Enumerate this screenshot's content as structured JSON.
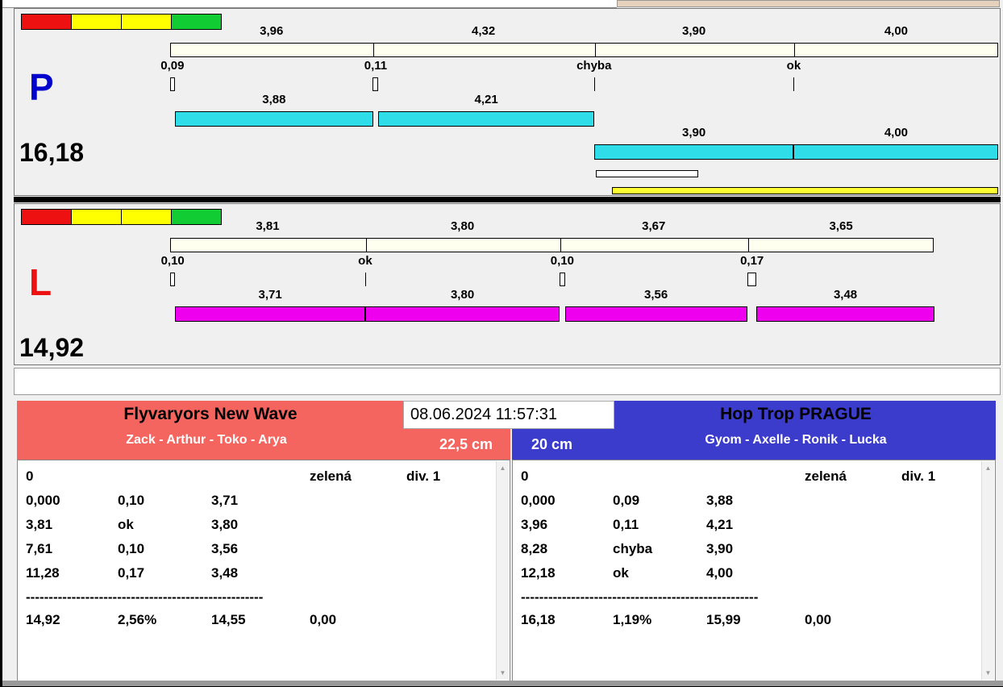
{
  "window": {
    "datetime": "08.06.2024 11:57:31"
  },
  "colors": {
    "p_accent": "#2fdde8",
    "l_accent": "#ee00ee",
    "ruler_fill": "#fffff0",
    "status_segments": [
      "#ee1111",
      "#ffff00",
      "#ffff00",
      "#11cc33"
    ],
    "left_team_bg": "#f5655f",
    "right_team_bg": "#3c3ccc",
    "p_label_color": "#0000cc",
    "l_label_color": "#ee1111",
    "progress_white": "#ffffff",
    "progress_yellow": "#ffff33"
  },
  "icons": {
    "scroll_up": "▲",
    "scroll_down": "▼"
  },
  "lanes": {
    "p": {
      "label": "P",
      "total": "16,18"
    },
    "l": {
      "label": "L",
      "total": "14,92"
    }
  },
  "teams": {
    "left": {
      "name": "Flyvaryors New Wave",
      "members": "Zack - Arthur - Toko - Arya",
      "jump_height": "22,5 cm"
    },
    "right": {
      "name": "Hop Trop PRAGUE",
      "members": "Gyom - Axelle - Ronik - Lucka",
      "jump_height": "20 cm"
    }
  },
  "tables": {
    "left": {
      "rows": [
        [
          {
            "col": 0,
            "text": "0"
          },
          {
            "col": 3,
            "text": "zelená"
          },
          {
            "col": 4,
            "text": "div. 1"
          }
        ],
        [
          {
            "col": 0,
            "text": "0,000"
          },
          {
            "col": 1,
            "text": "0,10"
          },
          {
            "col": 2,
            "text": "3,71"
          }
        ],
        [
          {
            "col": 0,
            "text": "3,81"
          },
          {
            "col": 1,
            "text": "ok"
          },
          {
            "col": 2,
            "text": "3,80"
          }
        ],
        [
          {
            "col": 0,
            "text": "7,61"
          },
          {
            "col": 1,
            "text": "0,10"
          },
          {
            "col": 2,
            "text": "3,56"
          }
        ],
        [
          {
            "col": 0,
            "text": "11,28"
          },
          {
            "col": 1,
            "text": "0,17"
          },
          {
            "col": 2,
            "text": "3,48"
          }
        ]
      ],
      "separator": "----------------------------------------------------",
      "summary": [
        {
          "col": 0,
          "text": "14,92"
        },
        {
          "col": 1,
          "text": "2,56%"
        },
        {
          "col": 2,
          "text": "14,55"
        },
        {
          "col": 3,
          "text": "0,00"
        }
      ]
    },
    "right": {
      "rows": [
        [
          {
            "col": 0,
            "text": "0"
          },
          {
            "col": 3,
            "text": "zelená"
          },
          {
            "col": 4,
            "text": "div. 1"
          }
        ],
        [
          {
            "col": 0,
            "text": "0,000"
          },
          {
            "col": 1,
            "text": "0,09"
          },
          {
            "col": 2,
            "text": "3,88"
          }
        ],
        [
          {
            "col": 0,
            "text": "3,96"
          },
          {
            "col": 1,
            "text": "0,11"
          },
          {
            "col": 2,
            "text": "4,21"
          }
        ],
        [
          {
            "col": 0,
            "text": "8,28"
          },
          {
            "col": 1,
            "text": "chyba"
          },
          {
            "col": 2,
            "text": "3,90"
          }
        ],
        [
          {
            "col": 0,
            "text": "12,18"
          },
          {
            "col": 1,
            "text": "ok"
          },
          {
            "col": 2,
            "text": "4,00"
          }
        ]
      ],
      "separator": "----------------------------------------------------",
      "summary": [
        {
          "col": 0,
          "text": "16,18"
        },
        {
          "col": 1,
          "text": "1,19%"
        },
        {
          "col": 2,
          "text": "15,99"
        },
        {
          "col": 3,
          "text": "0,00"
        }
      ]
    }
  },
  "chart_data": [
    {
      "type": "bar",
      "lane": "P",
      "title": "Lane P split times",
      "total": 16.18,
      "splits": [
        3.96,
        4.32,
        3.9,
        4.0
      ],
      "split_labels": [
        "3,96",
        "4,32",
        "3,90",
        "4,00"
      ],
      "start_deltas": [
        0.09,
        0.11,
        null,
        null
      ],
      "delta_labels": [
        "0,09",
        "0,11",
        "chyba",
        "ok"
      ],
      "dog_times": [
        3.88,
        4.21,
        3.9,
        4.0
      ],
      "dog_labels": [
        "3,88",
        "4,21",
        "3,90",
        "4,00"
      ],
      "bar_color": "#2fdde8"
    },
    {
      "type": "bar",
      "lane": "L",
      "title": "Lane L split times",
      "total": 14.92,
      "splits": [
        3.81,
        3.8,
        3.67,
        3.65
      ],
      "split_labels": [
        "3,81",
        "3,80",
        "3,67",
        "3,65"
      ],
      "start_deltas": [
        0.1,
        null,
        0.1,
        0.17
      ],
      "delta_labels": [
        "0,10",
        "ok",
        "0,10",
        "0,17"
      ],
      "dog_times": [
        3.71,
        3.8,
        3.56,
        3.48
      ],
      "dog_labels": [
        "3,71",
        "3,80",
        "3,56",
        "3,48"
      ],
      "bar_color": "#ee00ee"
    }
  ]
}
